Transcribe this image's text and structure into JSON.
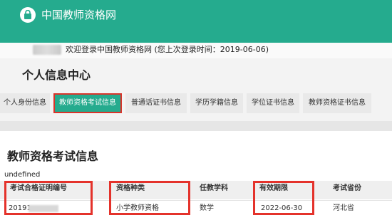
{
  "header": {
    "site_title": "中国教师资格网"
  },
  "welcome": {
    "text": "欢迎登录中国教师资格网 (您上次登录时间：2019-06-06)"
  },
  "page": {
    "title": "个人信息中心"
  },
  "tabs": [
    {
      "label": "个人身份信息"
    },
    {
      "label": "教师资格考试信息",
      "active": true
    },
    {
      "label": "普通话证书信息"
    },
    {
      "label": "学历学籍信息"
    },
    {
      "label": "学位证书信息"
    },
    {
      "label": "教师资格证书信息"
    }
  ],
  "section": {
    "title": "教师资格考试信息",
    "note": "undefined"
  },
  "table": {
    "headers": [
      "考试合格证明编号",
      "资格种类",
      "任教学科",
      "有效期限",
      "考试省份"
    ],
    "row": [
      "20191",
      "小学教师资格",
      "数学",
      "2022-06-30",
      "河北省"
    ]
  },
  "colors": {
    "brand": "#25ab8e",
    "highlight": "#e4322b"
  }
}
